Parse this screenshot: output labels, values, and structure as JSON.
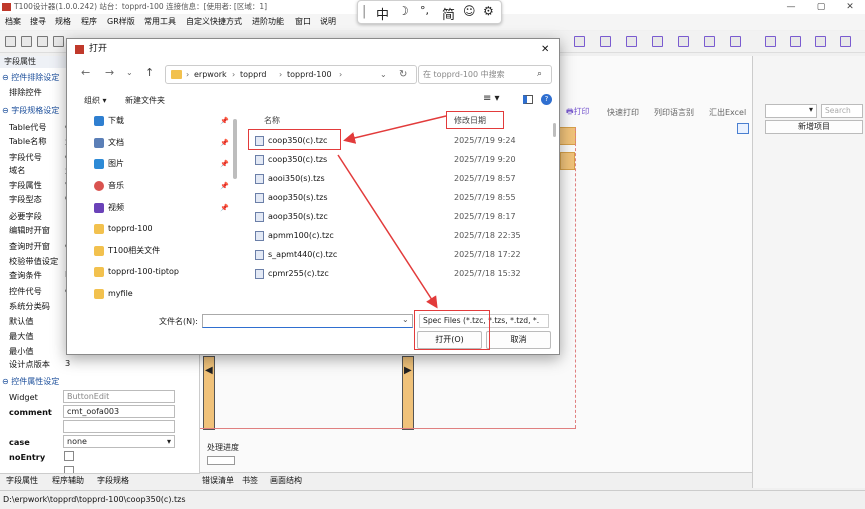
{
  "app": {
    "title": "T100设计器(1.0.0.242) 站台：topprd-100 连接信息：[使用者:                          [区域：1]",
    "window_controls": [
      "—",
      "▢",
      "✕"
    ]
  },
  "menubar": [
    "档案",
    "搜寻",
    "规格",
    "程序",
    "GR样版",
    "常用工具",
    "自定义快捷方式",
    "进阶功能",
    "窗口",
    "说明"
  ],
  "ime_bar": [
    "中",
    "°,",
    "简"
  ],
  "left_panel": {
    "tab_title": "字段属性",
    "sections": {
      "exclude": "控件排除设定",
      "spec": "字段规格设定",
      "property": "控件属性设定"
    },
    "rows": [
      {
        "label": "排除控件"
      },
      {
        "label": "Table代号",
        "value": "c"
      },
      {
        "label": "Table名称",
        "value": "量"
      },
      {
        "label": "字段代号",
        "value": "c"
      },
      {
        "label": "域名",
        "value": "量"
      },
      {
        "label": "字段属性",
        "value": "v"
      },
      {
        "label": "字段型态",
        "value": "C"
      },
      {
        "label": "必要字段"
      },
      {
        "label": "编辑时开窗"
      },
      {
        "label": "查询时开窗",
        "value": "c"
      },
      {
        "label": "校验带值设定"
      },
      {
        "label": "查询条件",
        "value": "II"
      },
      {
        "label": "控件代号",
        "value": "c"
      },
      {
        "label": "系统分类码"
      },
      {
        "label": "默认值"
      },
      {
        "label": "最大值"
      },
      {
        "label": "最小值"
      },
      {
        "label": "设计点版本",
        "value": "3"
      }
    ],
    "widget_label": "Widget",
    "widget_value": "ButtonEdit",
    "comment_label": "comment",
    "comment_value": "cmt_oofa003",
    "case_label": "case",
    "case_value": "none",
    "noentry_label": "noEntry",
    "bottom_tabs": [
      "字段属性",
      "程序辅助",
      "字段规格"
    ]
  },
  "canvas": {
    "toolbar_items": [
      "打印",
      "快速打印",
      "列印语言别",
      "汇出Excel"
    ],
    "progress_label": "处理进度",
    "tabs": [
      "错误清单",
      "书签",
      "画面结构"
    ]
  },
  "right_panel": {
    "search_placeholder": "Search",
    "add_button": "新增项目"
  },
  "dialog": {
    "title": "打开",
    "close": "✕",
    "breadcrumb": [
      "erpwork",
      "topprd",
      "topprd-100"
    ],
    "search_placeholder": "在 topprd-100 中搜索",
    "organize": "组织",
    "new_folder": "新建文件夹",
    "nav_items": [
      {
        "name": "下载",
        "color": "#2f7fd0",
        "pinned": true
      },
      {
        "name": "文档",
        "color": "#5b7fb7",
        "pinned": true
      },
      {
        "name": "图片",
        "color": "#2d8ad6",
        "pinned": true
      },
      {
        "name": "音乐",
        "color": "#d9534f",
        "pinned": true
      },
      {
        "name": "视频",
        "color": "#6a42b8",
        "pinned": true
      },
      {
        "name": "topprd-100",
        "color": "#f2c14e",
        "pinned": false
      },
      {
        "name": "T100相关文件",
        "color": "#f2c14e",
        "pinned": false
      },
      {
        "name": "topprd-100-tiptop",
        "color": "#f2c14e",
        "pinned": false
      },
      {
        "name": "myfile",
        "color": "#f2c14e",
        "pinned": false
      }
    ],
    "col_name": "名称",
    "col_date": "修改日期",
    "files": [
      {
        "name": "coop350(c).tzc",
        "date": "2025/7/19 9:24"
      },
      {
        "name": "coop350(c).tzs",
        "date": "2025/7/19 9:20"
      },
      {
        "name": "aooi350(s).tzs",
        "date": "2025/7/19 8:57"
      },
      {
        "name": "aoop350(s).tzs",
        "date": "2025/7/19 8:55"
      },
      {
        "name": "aoop350(s).tzc",
        "date": "2025/7/19 8:17"
      },
      {
        "name": "apmm100(c).tzc",
        "date": "2025/7/18 22:35"
      },
      {
        "name": "s_apmt440(c).tzc",
        "date": "2025/7/18 17:22"
      },
      {
        "name": "cpmr255(c).tzc",
        "date": "2025/7/18 15:32"
      }
    ],
    "filename_label": "文件名(N):",
    "filename_value": "",
    "filetype": "Spec Files (*.tzc, *.tzs, *.tzd, *.",
    "open_button": "打开(O)",
    "cancel_button": "取消",
    "accent": "#e23b3b"
  },
  "status": "D:\\erpwork\\topprd\\topprd-100\\coop350(c).tzs"
}
